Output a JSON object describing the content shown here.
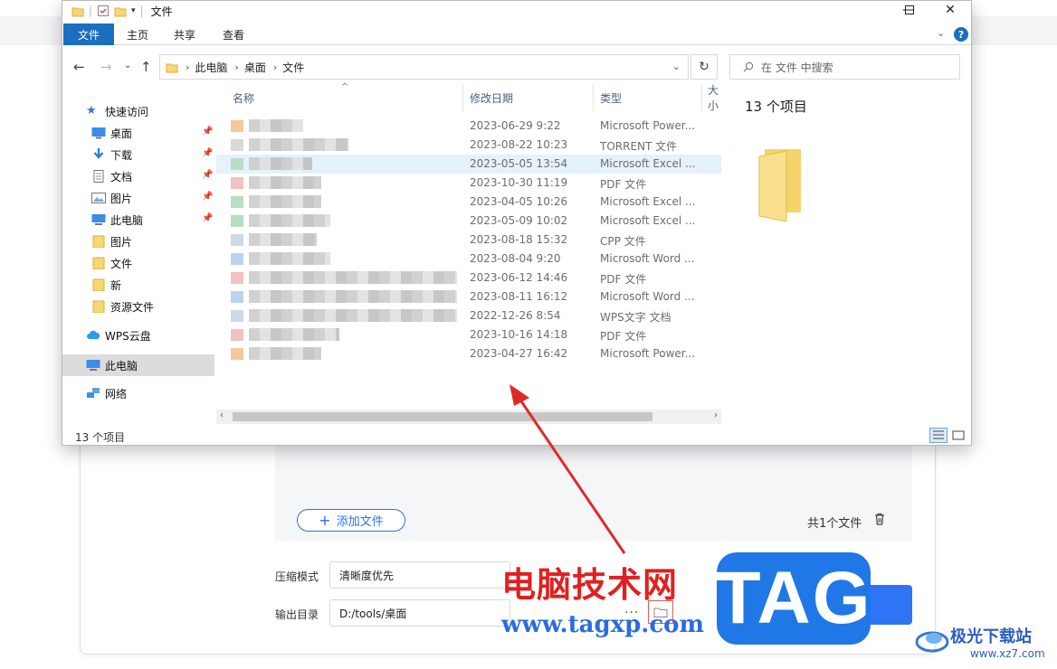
{
  "app": {
    "add_file_label": "添加文件",
    "file_count": "共1个文件",
    "compress_mode_label": "压缩模式",
    "compress_mode_value": "清晰度优先",
    "output_dir_label": "输出目录",
    "output_dir_value": "D:/tools/桌面",
    "browse_dots": "···",
    "accent_color": "#2f74f4"
  },
  "explorer": {
    "title": "文件",
    "ribbon_tabs": [
      "文件",
      "主页",
      "共享",
      "查看"
    ],
    "address": {
      "path": [
        "此电脑",
        "桌面",
        "文件"
      ]
    },
    "search_placeholder": "在 文件 中搜索",
    "nav": {
      "quick_access": "快速访问",
      "items": [
        "桌面",
        "下载",
        "文档",
        "图片",
        "此电脑",
        "图片",
        "文件",
        "新",
        "资源文件"
      ],
      "wps_cloud": "WPS云盘",
      "this_pc": "此电脑",
      "network": "网络"
    },
    "columns": {
      "name": "名称",
      "modified": "修改日期",
      "type": "类型",
      "size": "大小"
    },
    "files": [
      {
        "date": "2023-06-29 9:22",
        "type": "Microsoft Power..."
      },
      {
        "date": "2023-08-22 10:23",
        "type": "TORRENT 文件"
      },
      {
        "date": "2023-05-05 13:54",
        "type": "Microsoft Excel ..."
      },
      {
        "date": "2023-10-30 11:19",
        "type": "PDF 文件"
      },
      {
        "date": "2023-04-05 10:26",
        "type": "Microsoft Excel ..."
      },
      {
        "date": "2023-05-09 10:02",
        "type": "Microsoft Excel ..."
      },
      {
        "date": "2023-08-18 15:32",
        "type": "CPP 文件"
      },
      {
        "date": "2023-08-04 9:20",
        "type": "Microsoft Word ..."
      },
      {
        "date": "2023-06-12 14:46",
        "type": "PDF 文件"
      },
      {
        "date": "2023-08-11 16:12",
        "type": "Microsoft Word ..."
      },
      {
        "date": "2022-12-26 8:54",
        "type": "WPS文字 文档"
      },
      {
        "date": "2023-10-16 14:18",
        "type": "PDF 文件"
      },
      {
        "date": "2023-04-27 16:42",
        "type": "Microsoft Power..."
      }
    ],
    "preview_count": "13 个项目",
    "status": "13 个项目"
  },
  "watermark": {
    "cn": "电脑技术网",
    "url": "www.tagxp.com",
    "tag": "TAG",
    "brand": "极光下载站",
    "brand_url": "www.xz7.com"
  }
}
